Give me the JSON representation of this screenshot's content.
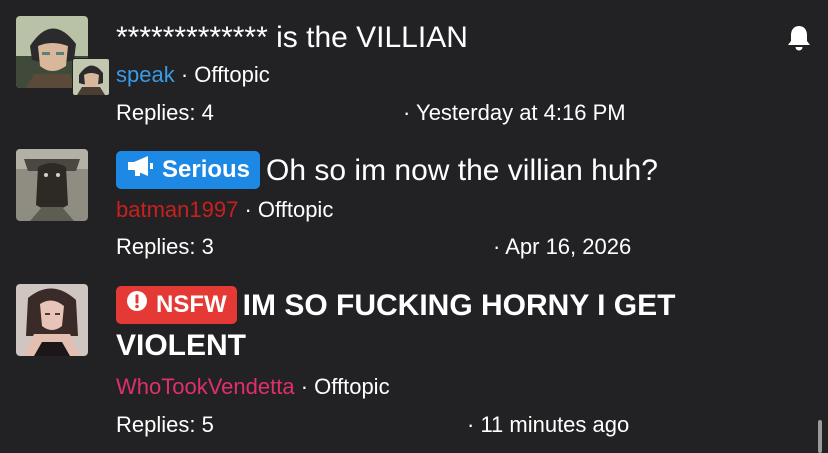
{
  "threads": [
    {
      "title": "************* is the VILLIAN",
      "author": "speak",
      "forum": "Offtopic",
      "replies": "Replies: 4",
      "date": "· Yesterday at 4:16 PM"
    },
    {
      "prefix": "Serious",
      "title": "Oh so im now the villian huh?",
      "author": "batman1997",
      "forum": "Offtopic",
      "replies": "Replies: 3",
      "date": "· Apr 16, 2026"
    },
    {
      "prefix": "NSFW",
      "title": "IM SO FUCKING HORNY I GET VIOLENT",
      "author": "WhoTookVendetta",
      "forum": "Offtopic",
      "replies": "Replies: 5",
      "date": "· 11 minutes ago"
    }
  ],
  "separator": "·",
  "icons": {
    "notification": "bell-icon",
    "serious_prefix": "megaphone-icon",
    "nsfw_prefix": "exclamation-circle-icon"
  },
  "colors": {
    "background": "#222224",
    "serious_prefix": "#1e88e5",
    "nsfw_prefix": "#e53935",
    "author_speak": "#3a9be6",
    "author_batman1997": "#c8201f",
    "author_whotookvendetta": "#e0306a"
  }
}
